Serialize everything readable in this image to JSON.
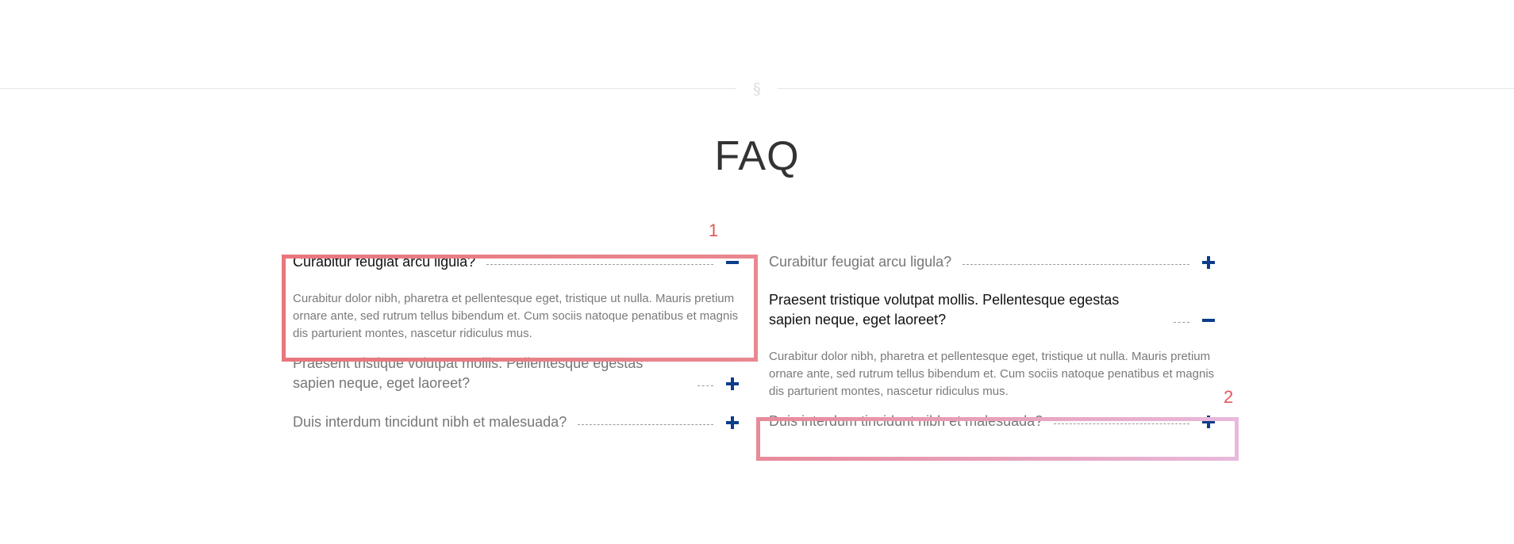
{
  "divider": {
    "symbol": "§"
  },
  "page_title": "FAQ",
  "faq": {
    "left": [
      {
        "question": "Curabitur feugiat arcu ligula?",
        "answer": "Curabitur dolor nibh, pharetra et pellentesque eget, tristique ut nulla. Mauris pretium ornare ante, sed rutrum tellus bibendum et. Cum sociis natoque penatibus et magnis dis parturient montes, nascetur ridiculus mus.",
        "expanded": true
      },
      {
        "question": "Praesent tristique volutpat mollis. Pellentesque egestas sapien neque, eget laoreet?",
        "expanded": false
      },
      {
        "question": "Duis interdum tincidunt nibh et malesuada?",
        "expanded": false
      }
    ],
    "right": [
      {
        "question": "Curabitur feugiat arcu ligula?",
        "expanded": false
      },
      {
        "question": "Praesent tristique volutpat mollis. Pellentesque egestas sapien neque, eget laoreet?",
        "answer": "Curabitur dolor nibh, pharetra et pellentesque eget, tristique ut nulla. Mauris pretium ornare ante, sed rutrum tellus bibendum et. Cum sociis natoque penatibus et magnis dis parturient montes, nascetur ridiculus mus.",
        "expanded": true
      },
      {
        "question": "Duis interdum tincidunt nibh et malesuada?",
        "expanded": false
      }
    ]
  },
  "annotations": {
    "label_1": "1",
    "label_2": "2"
  },
  "colors": {
    "toggle_icon": "#0c3d8a",
    "open_question_text": "#111111",
    "closed_question_text": "#777777",
    "annotation_label": "#e15858",
    "highlight_1": "#e8777d",
    "highlight_2_start": "#e88a9a",
    "highlight_2_end": "#e8b9dc"
  },
  "icons": {
    "expanded": "minus-icon",
    "collapsed": "plus-icon"
  }
}
